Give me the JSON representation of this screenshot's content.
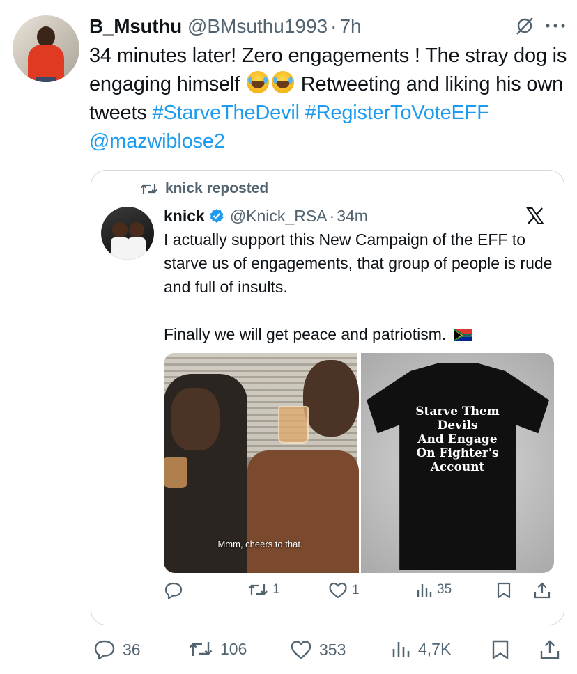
{
  "tweet": {
    "display_name": "B_Msuthu",
    "handle": "@BMsuthu1993",
    "separator": "·",
    "time": "7h",
    "text_part1": "34 minutes later! Zero engagements ! The  stray dog is engaging himself",
    "text_part2": "Retweeting and liking his own tweets",
    "hashtag1": "#StarveTheDevil",
    "hashtag2": "#RegisterToVoteEFF",
    "mention": "@mazwiblose2"
  },
  "quoted": {
    "repost_label": "knick reposted",
    "display_name": "knick",
    "handle": "@Knick_RSA",
    "separator": "·",
    "time": "34m",
    "para1": "I actually support this New Campaign of the EFF to starve us of engagements, that group of people is rude and full of insults.",
    "para2": "Finally we will get peace and patriotism.",
    "media_left_subtitle": "Mmm, cheers to that.",
    "shirt_lines": [
      "Starve Them",
      "Devils",
      "And Engage",
      "On Fighter's",
      "Account"
    ],
    "counts": {
      "reposts": "1",
      "likes": "1",
      "views": "35"
    }
  },
  "actions": {
    "replies": "36",
    "reposts": "106",
    "likes": "353",
    "views": "4,7K"
  },
  "colors": {
    "link": "#1d9bf0",
    "muted": "#536471",
    "verified": "#1d9bf0"
  }
}
